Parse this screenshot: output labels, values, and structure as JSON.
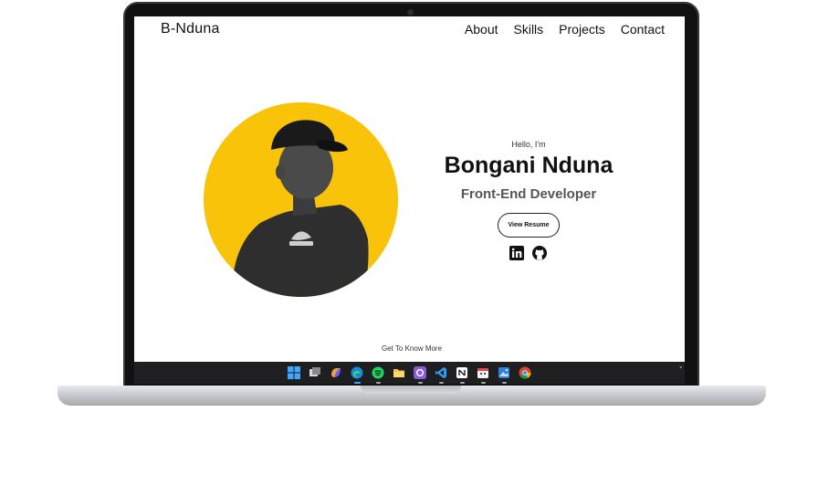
{
  "header": {
    "logo": "B-Nduna",
    "nav": [
      "About",
      "Skills",
      "Projects",
      "Contact"
    ]
  },
  "hero": {
    "greeting": "Hello, I'm",
    "name": "Bongani Nduna",
    "role": "Front-End Developer",
    "resume_label": "View Resume",
    "accent_color": "#f9c30a",
    "social_icons": [
      "linkedin-icon",
      "github-icon"
    ]
  },
  "footer_link": "Get To Know More",
  "taskbar": {
    "icons": [
      "windows-start-icon",
      "task-view-icon",
      "copilot-icon",
      "edge-icon",
      "spotify-icon",
      "file-explorer-icon",
      "github-desktop-icon",
      "vscode-icon",
      "notion-icon",
      "calendar-icon",
      "photos-icon",
      "chrome-icon"
    ]
  }
}
